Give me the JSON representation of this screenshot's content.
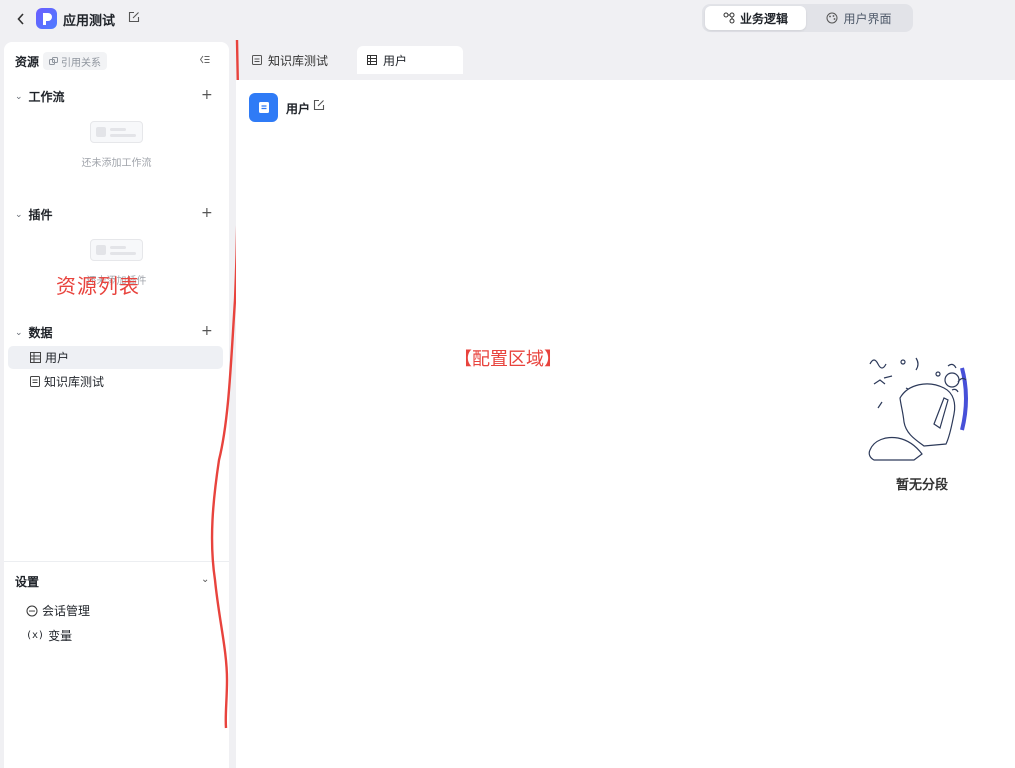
{
  "header": {
    "back_icon": "chevron-left-icon",
    "app_title": "应用测试",
    "segments": [
      {
        "label": "业务逻辑",
        "icon": "flow-icon",
        "active": true
      },
      {
        "label": "用户界面",
        "icon": "palette-icon",
        "active": false
      }
    ]
  },
  "sidebar": {
    "title": "资源",
    "ref_chip": "引用关系",
    "sections": {
      "workflow": {
        "title": "工作流",
        "empty": "还未添加工作流"
      },
      "plugin": {
        "title": "插件",
        "empty": "还未添加插件"
      },
      "data": {
        "title": "数据",
        "items": [
          "用户",
          "知识库测试"
        ]
      }
    },
    "annotation": "资源列表",
    "settings": {
      "title": "设置",
      "items": [
        "会话管理",
        "变量"
      ]
    }
  },
  "tabs": [
    {
      "label": "知识库测试",
      "active": false
    },
    {
      "label": "用户",
      "active": true
    }
  ],
  "content": {
    "doc_name": "用户",
    "annotation": "【配置区域】",
    "empty_text": "暂无分段"
  },
  "colors": {
    "accent": "#2f7bf6",
    "annotation": "#e8433d",
    "brand": "#6b5cff"
  }
}
